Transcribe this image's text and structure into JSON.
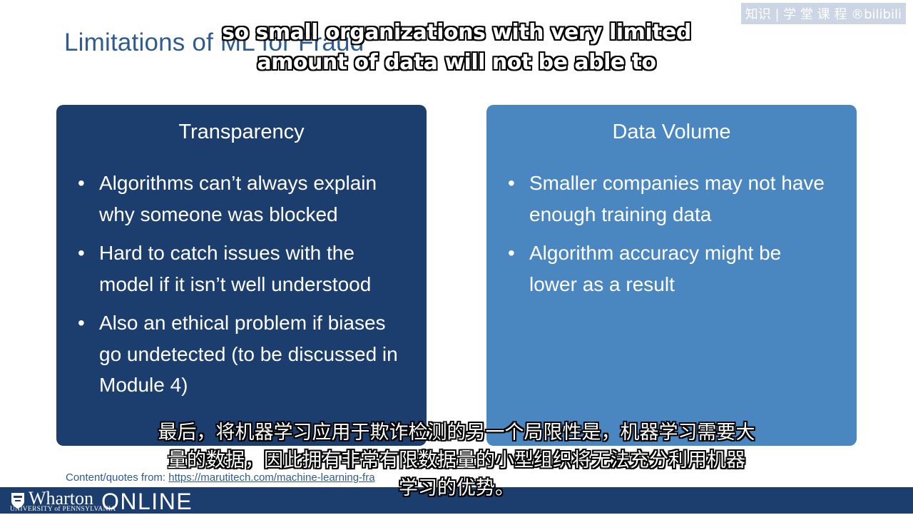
{
  "slide": {
    "title": "Limitations of ML for Fraud",
    "watermark": "知识 | 学 堂 课 程 ®bilibili"
  },
  "subtitles": {
    "english_line1": "so small organizations with very limited",
    "english_line2": "amount of data will not be able to",
    "chinese_line1": "最后，将机器学习应用于欺诈检测的另一个局限性是，机器学习需要大",
    "chinese_line2": "量的数据，因此拥有非常有限数据量的小型组织将无法充分利用机器",
    "chinese_line3": "学习的优势。"
  },
  "panels": {
    "transparency": {
      "heading": "Transparency",
      "bullets": [
        "Algorithms can’t always explain why someone was blocked",
        "Hard to catch issues with the model if it isn’t well understood",
        "Also an ethical problem if biases go undetected (to be discussed in Module 4)"
      ]
    },
    "data_volume": {
      "heading": "Data Volume",
      "bullets": [
        "Smaller companies may not have enough training data",
        "Algorithm accuracy might be lower as a result"
      ]
    }
  },
  "footer": {
    "source_prefix": "Content/quotes from: ",
    "source_link": "https://marutitech.com/machine-learning-fra",
    "brand_name": "Wharton",
    "brand_university": "UNIVERSITY of PENNSYLVANIA",
    "brand_online": "ONLINE"
  },
  "colors": {
    "title": "#2f5b8f",
    "panel_dark": "#1c3e6e",
    "panel_light": "#4a86c0",
    "footer": "#1c3e6e"
  },
  "icons": {
    "bullet": "•"
  }
}
